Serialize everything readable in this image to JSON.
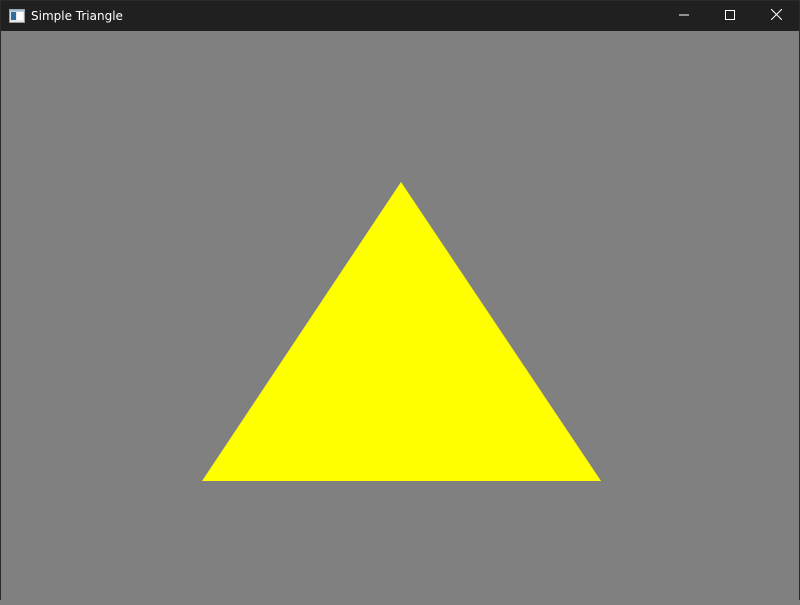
{
  "window": {
    "title": "Simple Triangle",
    "app_icon": "console-window-icon",
    "controls": [
      "minimize-icon",
      "maximize-icon",
      "close-icon"
    ]
  },
  "scene": {
    "background_color": "#808080",
    "shape": "triangle",
    "fill_color": "#ffff00"
  }
}
